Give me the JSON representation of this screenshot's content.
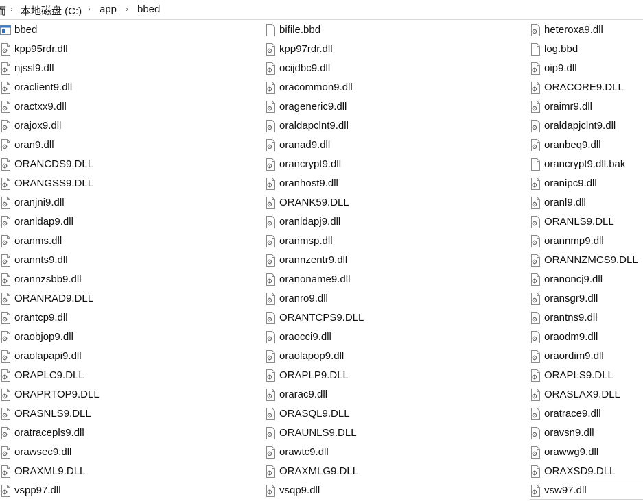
{
  "breadcrumb": {
    "items": [
      "而",
      "本地磁盘 (C:)",
      "app",
      "bbed"
    ],
    "separator": "›"
  },
  "files": {
    "col1": [
      {
        "name": "bbed",
        "icon": "application-icon"
      },
      {
        "name": "kpp95rdr.dll",
        "icon": "dll-file-icon"
      },
      {
        "name": "njssl9.dll",
        "icon": "dll-file-icon"
      },
      {
        "name": "oraclient9.dll",
        "icon": "dll-file-icon"
      },
      {
        "name": "oractxx9.dll",
        "icon": "dll-file-icon"
      },
      {
        "name": "orajox9.dll",
        "icon": "dll-file-icon"
      },
      {
        "name": "oran9.dll",
        "icon": "dll-file-icon"
      },
      {
        "name": "ORANCDS9.DLL",
        "icon": "dll-file-icon"
      },
      {
        "name": "ORANGSS9.DLL",
        "icon": "dll-file-icon"
      },
      {
        "name": "oranjni9.dll",
        "icon": "dll-file-icon"
      },
      {
        "name": "oranldap9.dll",
        "icon": "dll-file-icon"
      },
      {
        "name": "oranms.dll",
        "icon": "dll-file-icon"
      },
      {
        "name": "orannts9.dll",
        "icon": "dll-file-icon"
      },
      {
        "name": "orannzsbb9.dll",
        "icon": "dll-file-icon"
      },
      {
        "name": "ORANRAD9.DLL",
        "icon": "dll-file-icon"
      },
      {
        "name": "orantcp9.dll",
        "icon": "dll-file-icon"
      },
      {
        "name": "oraobjop9.dll",
        "icon": "dll-file-icon"
      },
      {
        "name": "oraolapapi9.dll",
        "icon": "dll-file-icon"
      },
      {
        "name": "ORAPLC9.DLL",
        "icon": "dll-file-icon"
      },
      {
        "name": "ORAPRTOP9.DLL",
        "icon": "dll-file-icon"
      },
      {
        "name": "ORASNLS9.DLL",
        "icon": "dll-file-icon"
      },
      {
        "name": "oratracepls9.dll",
        "icon": "dll-file-icon"
      },
      {
        "name": "orawsec9.dll",
        "icon": "dll-file-icon"
      },
      {
        "name": "ORAXML9.DLL",
        "icon": "dll-file-icon"
      },
      {
        "name": "vspp97.dll",
        "icon": "dll-file-icon"
      }
    ],
    "col2": [
      {
        "name": "bifile.bbd",
        "icon": "blank-file-icon"
      },
      {
        "name": "kpp97rdr.dll",
        "icon": "dll-file-icon"
      },
      {
        "name": "ocijdbc9.dll",
        "icon": "dll-file-icon"
      },
      {
        "name": "oracommon9.dll",
        "icon": "dll-file-icon"
      },
      {
        "name": "orageneric9.dll",
        "icon": "dll-file-icon"
      },
      {
        "name": "oraldapclnt9.dll",
        "icon": "dll-file-icon"
      },
      {
        "name": "oranad9.dll",
        "icon": "dll-file-icon"
      },
      {
        "name": "orancrypt9.dll",
        "icon": "dll-file-icon"
      },
      {
        "name": "oranhost9.dll",
        "icon": "dll-file-icon"
      },
      {
        "name": "ORANK59.DLL",
        "icon": "dll-file-icon"
      },
      {
        "name": "oranldapj9.dll",
        "icon": "dll-file-icon"
      },
      {
        "name": "oranmsp.dll",
        "icon": "dll-file-icon"
      },
      {
        "name": "orannzentr9.dll",
        "icon": "dll-file-icon"
      },
      {
        "name": "oranoname9.dll",
        "icon": "dll-file-icon"
      },
      {
        "name": "oranro9.dll",
        "icon": "dll-file-icon"
      },
      {
        "name": "ORANTCPS9.DLL",
        "icon": "dll-file-icon"
      },
      {
        "name": "oraocci9.dll",
        "icon": "dll-file-icon"
      },
      {
        "name": "oraolapop9.dll",
        "icon": "dll-file-icon"
      },
      {
        "name": "ORAPLP9.DLL",
        "icon": "dll-file-icon"
      },
      {
        "name": "orarac9.dll",
        "icon": "dll-file-icon"
      },
      {
        "name": "ORASQL9.DLL",
        "icon": "dll-file-icon"
      },
      {
        "name": "ORAUNLS9.DLL",
        "icon": "dll-file-icon"
      },
      {
        "name": "orawtc9.dll",
        "icon": "dll-file-icon"
      },
      {
        "name": "ORAXMLG9.DLL",
        "icon": "dll-file-icon"
      },
      {
        "name": "vsqp9.dll",
        "icon": "dll-file-icon"
      }
    ],
    "col3": [
      {
        "name": "heteroxa9.dll",
        "icon": "dll-file-icon"
      },
      {
        "name": "log.bbd",
        "icon": "blank-file-icon"
      },
      {
        "name": "oip9.dll",
        "icon": "dll-file-icon"
      },
      {
        "name": "ORACORE9.DLL",
        "icon": "dll-file-icon"
      },
      {
        "name": "oraimr9.dll",
        "icon": "dll-file-icon"
      },
      {
        "name": "oraldapjclnt9.dll",
        "icon": "dll-file-icon"
      },
      {
        "name": "oranbeq9.dll",
        "icon": "dll-file-icon"
      },
      {
        "name": "orancrypt9.dll.bak",
        "icon": "blank-file-icon"
      },
      {
        "name": "oranipc9.dll",
        "icon": "dll-file-icon"
      },
      {
        "name": "oranl9.dll",
        "icon": "dll-file-icon"
      },
      {
        "name": "ORANLS9.DLL",
        "icon": "dll-file-icon"
      },
      {
        "name": "orannmp9.dll",
        "icon": "dll-file-icon"
      },
      {
        "name": "ORANNZMCS9.DLL",
        "icon": "dll-file-icon"
      },
      {
        "name": "oranoncj9.dll",
        "icon": "dll-file-icon"
      },
      {
        "name": "oransgr9.dll",
        "icon": "dll-file-icon"
      },
      {
        "name": "orantns9.dll",
        "icon": "dll-file-icon"
      },
      {
        "name": "oraodm9.dll",
        "icon": "dll-file-icon"
      },
      {
        "name": "oraordim9.dll",
        "icon": "dll-file-icon"
      },
      {
        "name": "ORAPLS9.DLL",
        "icon": "dll-file-icon"
      },
      {
        "name": "ORASLAX9.DLL",
        "icon": "dll-file-icon"
      },
      {
        "name": "oratrace9.dll",
        "icon": "dll-file-icon"
      },
      {
        "name": "oravsn9.dll",
        "icon": "dll-file-icon"
      },
      {
        "name": "orawwg9.dll",
        "icon": "dll-file-icon"
      },
      {
        "name": "ORAXSD9.DLL",
        "icon": "dll-file-icon"
      },
      {
        "name": "vsw97.dll",
        "icon": "dll-file-icon",
        "selected": true
      }
    ]
  }
}
